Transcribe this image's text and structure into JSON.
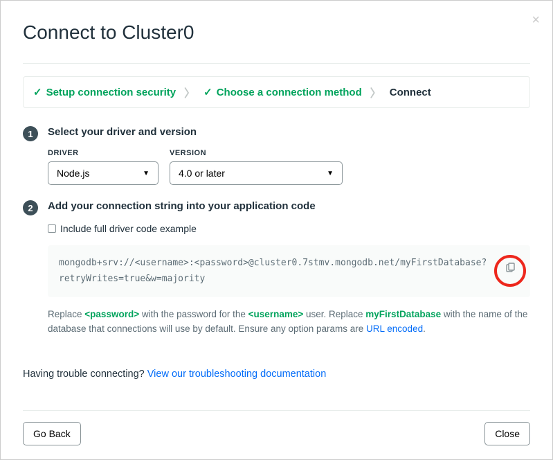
{
  "title": "Connect to Cluster0",
  "steps": {
    "one": "Setup connection security",
    "two": "Choose a connection method",
    "three": "Connect"
  },
  "section1": {
    "title": "Select your driver and version",
    "driver_label": "DRIVER",
    "driver_value": "Node.js",
    "version_label": "VERSION",
    "version_value": "4.0 or later"
  },
  "section2": {
    "title": "Add your connection string into your application code",
    "checkbox_label": "Include full driver code example",
    "connection_string": "mongodb+srv://<username>:<password>@cluster0.7stmv.mongodb.net/myFirstDatabase?retryWrites=true&w=majority",
    "helper_prefix": "Replace ",
    "helper_pw": "<password>",
    "helper_mid1": " with the password for the ",
    "helper_user": "<username>",
    "helper_mid2": " user. Replace ",
    "helper_db": "myFirstDatabase",
    "helper_mid3": " with the name of the database that connections will use by default. Ensure any option params are ",
    "helper_link": "URL encoded",
    "helper_suffix": "."
  },
  "trouble": {
    "text": "Having trouble connecting? ",
    "link": "View our troubleshooting documentation"
  },
  "footer": {
    "back": "Go Back",
    "close": "Close"
  }
}
